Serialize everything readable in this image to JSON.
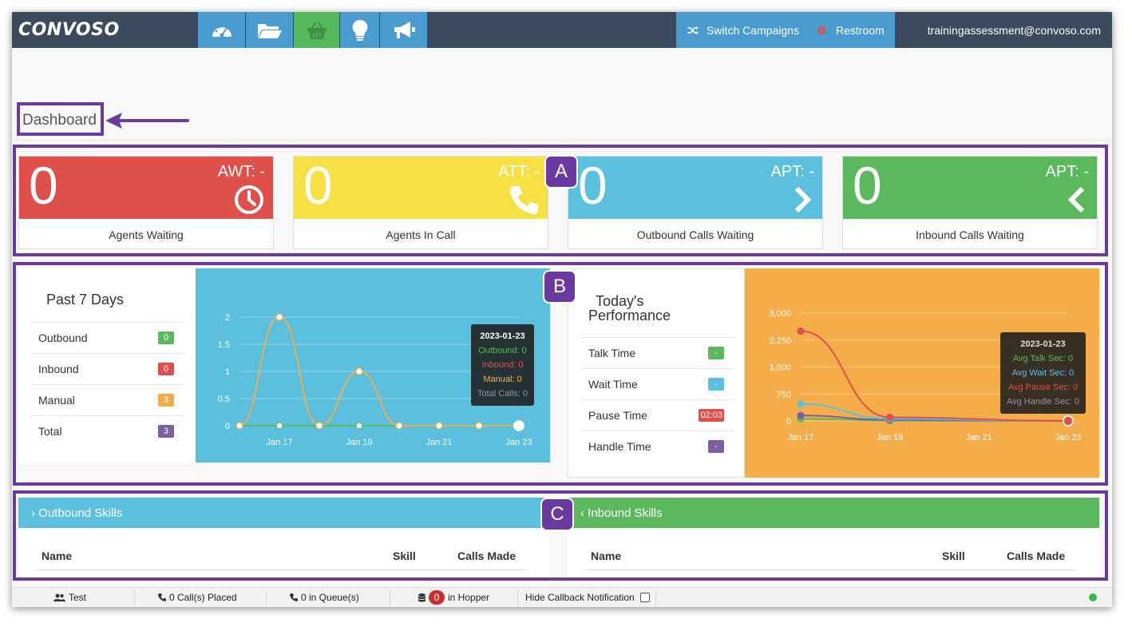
{
  "nav": {
    "logo": "CONVOSO",
    "icons": [
      "dashboard-gauge-icon",
      "folder-icon",
      "basket-icon",
      "lightbulb-icon",
      "megaphone-icon"
    ],
    "switch_campaigns": "Switch Campaigns",
    "restroom": "Restroom",
    "user_email": "trainingassessment@convoso.com"
  },
  "page": {
    "title": "Dashboard"
  },
  "annotations": {
    "a": "A",
    "b": "B",
    "c": "C"
  },
  "stats": [
    {
      "value": "0",
      "abbr": "AWT: -",
      "label": "Agents Waiting",
      "color": "#e0504a",
      "icon": "clock-icon"
    },
    {
      "value": "0",
      "abbr": "ATT: -",
      "label": "Agents In Call",
      "color": "#f7e043",
      "icon": "phone-icon"
    },
    {
      "value": "0",
      "abbr": "APT: -",
      "label": "Outbound Calls Waiting",
      "color": "#5bc0de",
      "icon": "chevron-right-icon"
    },
    {
      "value": "0",
      "abbr": "APT: -",
      "label": "Inbound Calls Waiting",
      "color": "#5cb85c",
      "icon": "chevron-left-icon"
    }
  ],
  "past7": {
    "title": "Past 7 Days",
    "rows": [
      {
        "label": "Outbound",
        "value": "0",
        "color": "#5cb85c"
      },
      {
        "label": "Inbound",
        "value": "0",
        "color": "#e0504a"
      },
      {
        "label": "Manual",
        "value": "3",
        "color": "#f0ad4e"
      },
      {
        "label": "Total",
        "value": "3",
        "color": "#7b5fa0"
      }
    ],
    "tooltip": {
      "date": "2023-01-23",
      "outbound": "Outbound: 0",
      "inbound": "Inbound: 0",
      "manual": "Manual: 0",
      "total": "Total Calls: 0"
    }
  },
  "today": {
    "title_line1": "Today's",
    "title_line2": "Performance",
    "rows": [
      {
        "label": "Talk Time",
        "value": "-",
        "color": "#5cb85c"
      },
      {
        "label": "Wait Time",
        "value": "-",
        "color": "#5bc0de"
      },
      {
        "label": "Pause Time",
        "value": "02:03",
        "color": "#e0504a"
      },
      {
        "label": "Handle Time",
        "value": "-",
        "color": "#7b5fa0"
      }
    ],
    "tooltip": {
      "date": "2023-01-23",
      "talk": "Avg Talk Sec: 0",
      "wait": "Avg Wait Sec: 0",
      "pause": "Avg Pause Sec: 0",
      "handle": "Avg Handle Sec: 0"
    }
  },
  "chart_data": [
    {
      "type": "line",
      "x": [
        "Jan 16",
        "Jan 17",
        "Jan 18",
        "Jan 19",
        "Jan 20",
        "Jan 21",
        "Jan 22",
        "Jan 23"
      ],
      "x_tick_labels": [
        "Jan 17",
        "Jan 19",
        "Jan 21",
        "Jan 23"
      ],
      "y_tick_labels": [
        "0",
        "0.5",
        "1",
        "1.5",
        "2"
      ],
      "ylim": [
        0,
        2
      ],
      "grid": true,
      "series": [
        {
          "name": "Manual",
          "values": [
            0,
            2,
            0,
            1,
            0,
            0,
            0,
            0
          ],
          "color": "#f0ad4e"
        },
        {
          "name": "Outbound",
          "values": [
            0,
            0,
            0,
            0,
            0,
            0,
            0,
            0
          ],
          "color": "#5cb85c"
        }
      ]
    },
    {
      "type": "line",
      "x": [
        "Jan 17",
        "Jan 19",
        "Jan 23"
      ],
      "x_tick_labels": [
        "Jan 17",
        "Jan 19",
        "Jan 21",
        "Jan 23"
      ],
      "y_tick_labels": [
        "0",
        "750",
        "1,500",
        "2,250",
        "3,000"
      ],
      "ylim": [
        0,
        3000
      ],
      "grid": true,
      "series": [
        {
          "name": "Avg Pause Sec",
          "values": [
            2500,
            100,
            0
          ],
          "color": "#e0504a"
        },
        {
          "name": "Avg Wait Sec",
          "values": [
            470,
            60,
            0
          ],
          "color": "#5bc0de"
        },
        {
          "name": "Avg Handle Sec",
          "values": [
            150,
            30,
            0
          ],
          "color": "#7b5fa0"
        },
        {
          "name": "Avg Talk Sec",
          "values": [
            60,
            10,
            0
          ],
          "color": "#5cb85c"
        }
      ]
    }
  ],
  "skills": {
    "outbound_title": "Outbound Skills",
    "inbound_title": "Inbound Skills",
    "col_name": "Name",
    "col_skill": "Skill",
    "col_calls": "Calls Made"
  },
  "status": {
    "campaign": "Test",
    "placed": "0 Call(s) Placed",
    "queue": "0 in Queue(s)",
    "hopper_count": "0",
    "hopper": "in Hopper",
    "hide_callback": "Hide Callback Notification"
  }
}
